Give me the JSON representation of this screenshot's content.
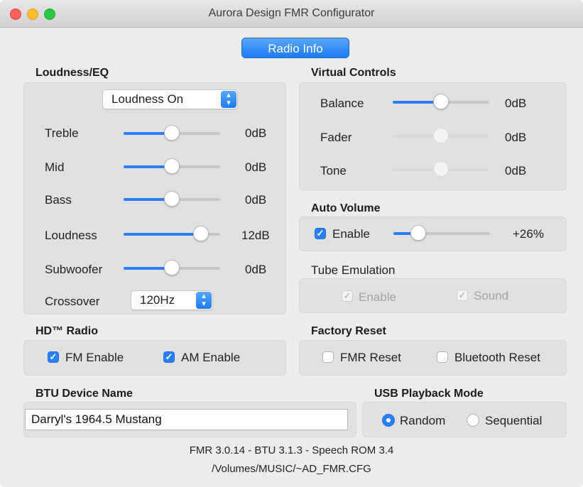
{
  "window": {
    "title": "Aurora Design FMR Configurator"
  },
  "radio_info_button": "Radio Info",
  "loudness_eq": {
    "title": "Loudness/EQ",
    "mode_select": "Loudness On",
    "sliders": [
      {
        "label": "Treble",
        "value": "0dB",
        "level": 0.5
      },
      {
        "label": "Mid",
        "value": "0dB",
        "level": 0.5
      },
      {
        "label": "Bass",
        "value": "0dB",
        "level": 0.5
      },
      {
        "label": "Loudness",
        "value": "12dB",
        "level": 0.8
      },
      {
        "label": "Subwoofer",
        "value": "0dB",
        "level": 0.5
      }
    ],
    "crossover": {
      "label": "Crossover",
      "value": "120Hz"
    }
  },
  "virtual_controls": {
    "title": "Virtual Controls",
    "sliders": [
      {
        "label": "Balance",
        "value": "0dB",
        "level": 0.5,
        "enabled": true
      },
      {
        "label": "Fader",
        "value": "0dB",
        "level": 0.5,
        "enabled": false
      },
      {
        "label": "Tone",
        "value": "0dB",
        "level": 0.5,
        "enabled": false
      }
    ]
  },
  "auto_volume": {
    "title": "Auto Volume",
    "enable_label": "Enable",
    "enabled": true,
    "value": "+26%",
    "level": 0.26
  },
  "tube_emulation": {
    "title": "Tube Emulation",
    "enable_label": "Enable",
    "sound_label": "Sound"
  },
  "hd_radio": {
    "title": "HD™ Radio",
    "fm_label": "FM Enable",
    "am_label": "AM Enable"
  },
  "factory_reset": {
    "title": "Factory Reset",
    "fmr_label": "FMR Reset",
    "bt_label": "Bluetooth Reset"
  },
  "btu_device": {
    "title": "BTU Device Name",
    "value": "Darryl's 1964.5 Mustang"
  },
  "usb_playback": {
    "title": "USB Playback Mode",
    "random_label": "Random",
    "sequential_label": "Sequential",
    "selected": "Random"
  },
  "footer": {
    "versions": "FMR 3.0.14  -  BTU 3.1.3  -  Speech ROM 3.4",
    "path": "/Volumes/MUSIC/~AD_FMR.CFG"
  },
  "colors": {
    "accent": "#2b7ff6",
    "panel": "#e1e1e1",
    "window": "#ececec"
  }
}
